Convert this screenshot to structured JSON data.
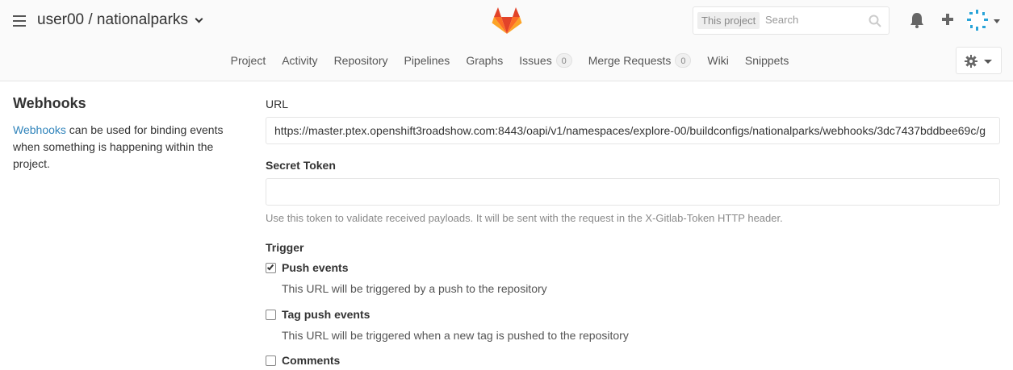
{
  "header": {
    "project_path": "user00 / nationalparks",
    "search": {
      "scope": "This project",
      "placeholder": "Search"
    }
  },
  "nav": {
    "items": [
      {
        "label": "Project"
      },
      {
        "label": "Activity"
      },
      {
        "label": "Repository"
      },
      {
        "label": "Pipelines"
      },
      {
        "label": "Graphs"
      },
      {
        "label": "Issues",
        "badge": "0"
      },
      {
        "label": "Merge Requests",
        "badge": "0"
      },
      {
        "label": "Wiki"
      },
      {
        "label": "Snippets"
      }
    ]
  },
  "sidebar": {
    "heading": "Webhooks",
    "link_text": "Webhooks",
    "description": " can be used for binding events when something is happening within the project."
  },
  "form": {
    "url_label": "URL",
    "url_value": "https://master.ptex.openshift3roadshow.com:8443/oapi/v1/namespaces/explore-00/buildconfigs/nationalparks/webhooks/3dc7437bddbee69c/g",
    "secret_label": "Secret Token",
    "secret_value": "",
    "secret_help": "Use this token to validate received payloads. It will be sent with the request in the X-Gitlab-Token HTTP header.",
    "trigger_label": "Trigger",
    "triggers": [
      {
        "label": "Push events",
        "description": "This URL will be triggered by a push to the repository",
        "checked": true
      },
      {
        "label": "Tag push events",
        "description": "This URL will be triggered when a new tag is pushed to the repository",
        "checked": false
      },
      {
        "label": "Comments",
        "description": "",
        "checked": false
      }
    ]
  },
  "colors": {
    "accent": "#3084bb",
    "logo_orange": "#e24329",
    "logo_light": "#fca326",
    "logo_mid": "#fc6d26"
  }
}
